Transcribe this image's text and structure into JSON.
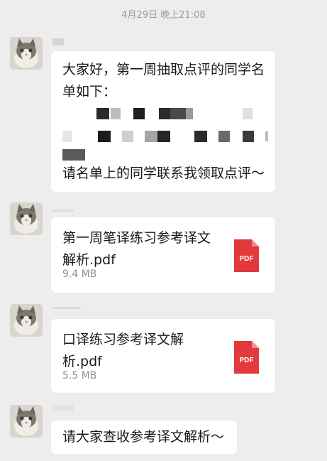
{
  "chat": {
    "timestamp": "4月29日 晚上21:08",
    "messages": [
      {
        "type": "text",
        "line1": "大家好，第一周抽取点评的同学名",
        "line2": "单如下：",
        "line_last": "请名单上的同学联系我领取点评～"
      },
      {
        "type": "file",
        "file_name": "第一周笔译练习参考译文解析.pdf",
        "file_size": "9.4 MB",
        "file_icon": "pdf-file-icon",
        "icon_label": "PDF"
      },
      {
        "type": "file",
        "file_name": "口译练习参考译文解析.pdf",
        "file_size": "5.5 MB",
        "file_icon": "pdf-file-icon",
        "icon_label": "PDF"
      },
      {
        "type": "text",
        "line1": "请大家查收参考译文解析～"
      }
    ]
  },
  "colors": {
    "background": "#ededed",
    "bubble": "#ffffff",
    "pdf_red": "#e4393c",
    "timestamp_text": "#9b9b9b"
  }
}
